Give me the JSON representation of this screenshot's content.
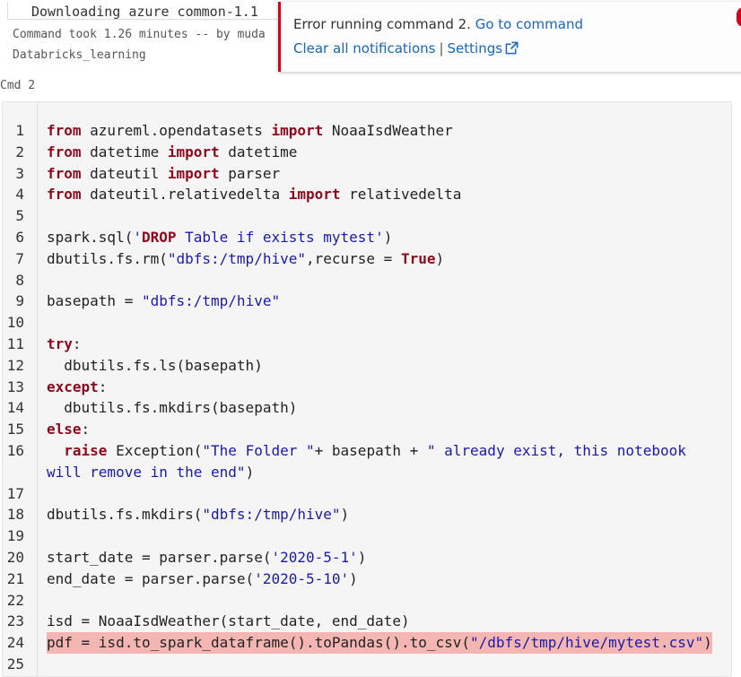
{
  "previous_cell": {
    "output_line": "Downloading azure common-1.1",
    "command_took": "Command took 1.26 minutes -- by muda",
    "notebook_name": "Databricks_learning"
  },
  "notification": {
    "message": "Error running command 2.",
    "go_to_command": "Go to command",
    "clear_all": "Clear all notifications",
    "separator": "|",
    "settings": "Settings",
    "accent_color": "#d9001b",
    "icon": "external-link-icon"
  },
  "cell": {
    "label": "Cmd 2",
    "highlight_line": 24,
    "highlight_color": "#f4b6b2",
    "lines": [
      {
        "num": "1",
        "segments": [
          {
            "t": "from",
            "c": "kw"
          },
          {
            "t": " azureml.opendatasets "
          },
          {
            "t": "import",
            "c": "kw"
          },
          {
            "t": " NoaaIsdWeather"
          }
        ]
      },
      {
        "num": "2",
        "segments": [
          {
            "t": "from",
            "c": "kw"
          },
          {
            "t": " datetime "
          },
          {
            "t": "import",
            "c": "kw"
          },
          {
            "t": " datetime"
          }
        ]
      },
      {
        "num": "3",
        "segments": [
          {
            "t": "from",
            "c": "kw"
          },
          {
            "t": " dateutil "
          },
          {
            "t": "import",
            "c": "kw"
          },
          {
            "t": " parser"
          }
        ]
      },
      {
        "num": "4",
        "segments": [
          {
            "t": "from",
            "c": "kw"
          },
          {
            "t": " dateutil.relativedelta "
          },
          {
            "t": "import",
            "c": "kw"
          },
          {
            "t": " relativedelta"
          }
        ]
      },
      {
        "num": "5",
        "segments": []
      },
      {
        "num": "6",
        "segments": [
          {
            "t": "spark.sql("
          },
          {
            "t": "'",
            "c": "str"
          },
          {
            "t": "DROP",
            "c": "kw"
          },
          {
            "t": " Table if exists mytest",
            "c": "str"
          },
          {
            "t": "'",
            "c": "str"
          },
          {
            "t": ")"
          }
        ]
      },
      {
        "num": "7",
        "segments": [
          {
            "t": "dbutils.fs.rm("
          },
          {
            "t": "\"dbfs:/tmp/hive\"",
            "c": "str"
          },
          {
            "t": ",recurse = "
          },
          {
            "t": "True",
            "c": "kw"
          },
          {
            "t": ")"
          }
        ]
      },
      {
        "num": "8",
        "segments": []
      },
      {
        "num": "9",
        "segments": [
          {
            "t": "basepath = "
          },
          {
            "t": "\"dbfs:/tmp/hive\"",
            "c": "str"
          }
        ]
      },
      {
        "num": "10",
        "segments": []
      },
      {
        "num": "11",
        "segments": [
          {
            "t": "try",
            "c": "kw"
          },
          {
            "t": ":"
          }
        ]
      },
      {
        "num": "12",
        "segments": [
          {
            "t": "  dbutils.fs.ls(basepath)"
          }
        ]
      },
      {
        "num": "13",
        "segments": [
          {
            "t": "except",
            "c": "kw"
          },
          {
            "t": ":"
          }
        ]
      },
      {
        "num": "14",
        "segments": [
          {
            "t": "  dbutils.fs.mkdirs(basepath)"
          }
        ]
      },
      {
        "num": "15",
        "segments": [
          {
            "t": "else",
            "c": "kw"
          },
          {
            "t": ":"
          }
        ]
      },
      {
        "num": "16",
        "segments": [
          {
            "t": "  "
          },
          {
            "t": "raise",
            "c": "kw"
          },
          {
            "t": " Exception("
          },
          {
            "t": "\"The Folder \"",
            "c": "str"
          },
          {
            "t": "+ basepath + "
          },
          {
            "t": "\" already exist, this notebook",
            "c": "str"
          }
        ]
      },
      {
        "num": "",
        "segments": [
          {
            "t": "will remove in the end\"",
            "c": "str"
          },
          {
            "t": ")"
          }
        ]
      },
      {
        "num": "17",
        "segments": []
      },
      {
        "num": "18",
        "segments": [
          {
            "t": "dbutils.fs.mkdirs("
          },
          {
            "t": "\"dbfs:/tmp/hive\"",
            "c": "str"
          },
          {
            "t": ")"
          }
        ]
      },
      {
        "num": "19",
        "segments": []
      },
      {
        "num": "20",
        "segments": [
          {
            "t": "start_date = parser.parse("
          },
          {
            "t": "'2020-5-1'",
            "c": "str"
          },
          {
            "t": ")"
          }
        ]
      },
      {
        "num": "21",
        "segments": [
          {
            "t": "end_date = parser.parse("
          },
          {
            "t": "'2020-5-10'",
            "c": "str"
          },
          {
            "t": ")"
          }
        ]
      },
      {
        "num": "22",
        "segments": []
      },
      {
        "num": "23",
        "segments": [
          {
            "t": "isd = NoaaIsdWeather(start_date, end_date)"
          }
        ]
      },
      {
        "num": "24",
        "segments": [
          {
            "t": "pdf = isd.to_spark_dataframe().toPandas().to_csv("
          },
          {
            "t": "\"/dbfs/tmp/hive/mytest.csv\"",
            "c": "str"
          },
          {
            "t": ")"
          }
        ]
      },
      {
        "num": "25",
        "segments": []
      }
    ]
  }
}
